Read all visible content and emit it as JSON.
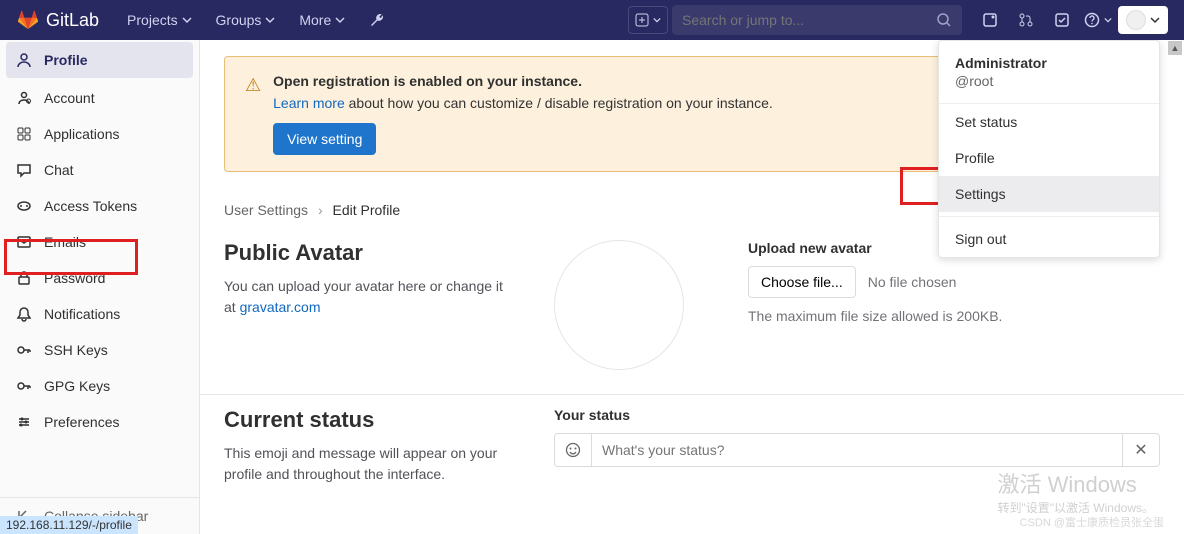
{
  "header": {
    "brand": "GitLab",
    "nav": [
      "Projects",
      "Groups",
      "More"
    ],
    "search_placeholder": "Search or jump to..."
  },
  "sidebar": {
    "items": [
      {
        "label": "Profile",
        "active": true
      },
      {
        "label": "Account"
      },
      {
        "label": "Applications"
      },
      {
        "label": "Chat"
      },
      {
        "label": "Access Tokens"
      },
      {
        "label": "Emails"
      },
      {
        "label": "Password"
      },
      {
        "label": "Notifications"
      },
      {
        "label": "SSH Keys"
      },
      {
        "label": "GPG Keys"
      },
      {
        "label": "Preferences"
      }
    ],
    "collapse": "Collapse sidebar"
  },
  "alert": {
    "title": "Open registration is enabled on your instance.",
    "learn_more": "Learn more",
    "text_rest": " about how you can customize / disable registration on your instance.",
    "button": "View setting"
  },
  "breadcrumb": {
    "parent": "User Settings",
    "current": "Edit Profile"
  },
  "avatar_section": {
    "heading": "Public Avatar",
    "desc_pre": "You can upload your avatar here or change it at ",
    "link": "gravatar.com",
    "upload_heading": "Upload new avatar",
    "choose_file": "Choose file...",
    "no_file": "No file chosen",
    "max_size": "The maximum file size allowed is 200KB."
  },
  "status_section": {
    "heading": "Current status",
    "desc": "This emoji and message will appear on your profile and throughout the interface.",
    "your_status": "Your status",
    "placeholder": "What's your status?"
  },
  "dropdown": {
    "name": "Administrator",
    "handle": "@root",
    "items": [
      "Set status",
      "Profile",
      "Settings"
    ],
    "sign_out": "Sign out"
  },
  "url": "192.168.11.129/-/profile",
  "watermark": {
    "big": "激活 Windows",
    "small": "转到\"设置\"以激活 Windows。"
  },
  "csdn": "CSDN @富士康质检员张全蛋"
}
